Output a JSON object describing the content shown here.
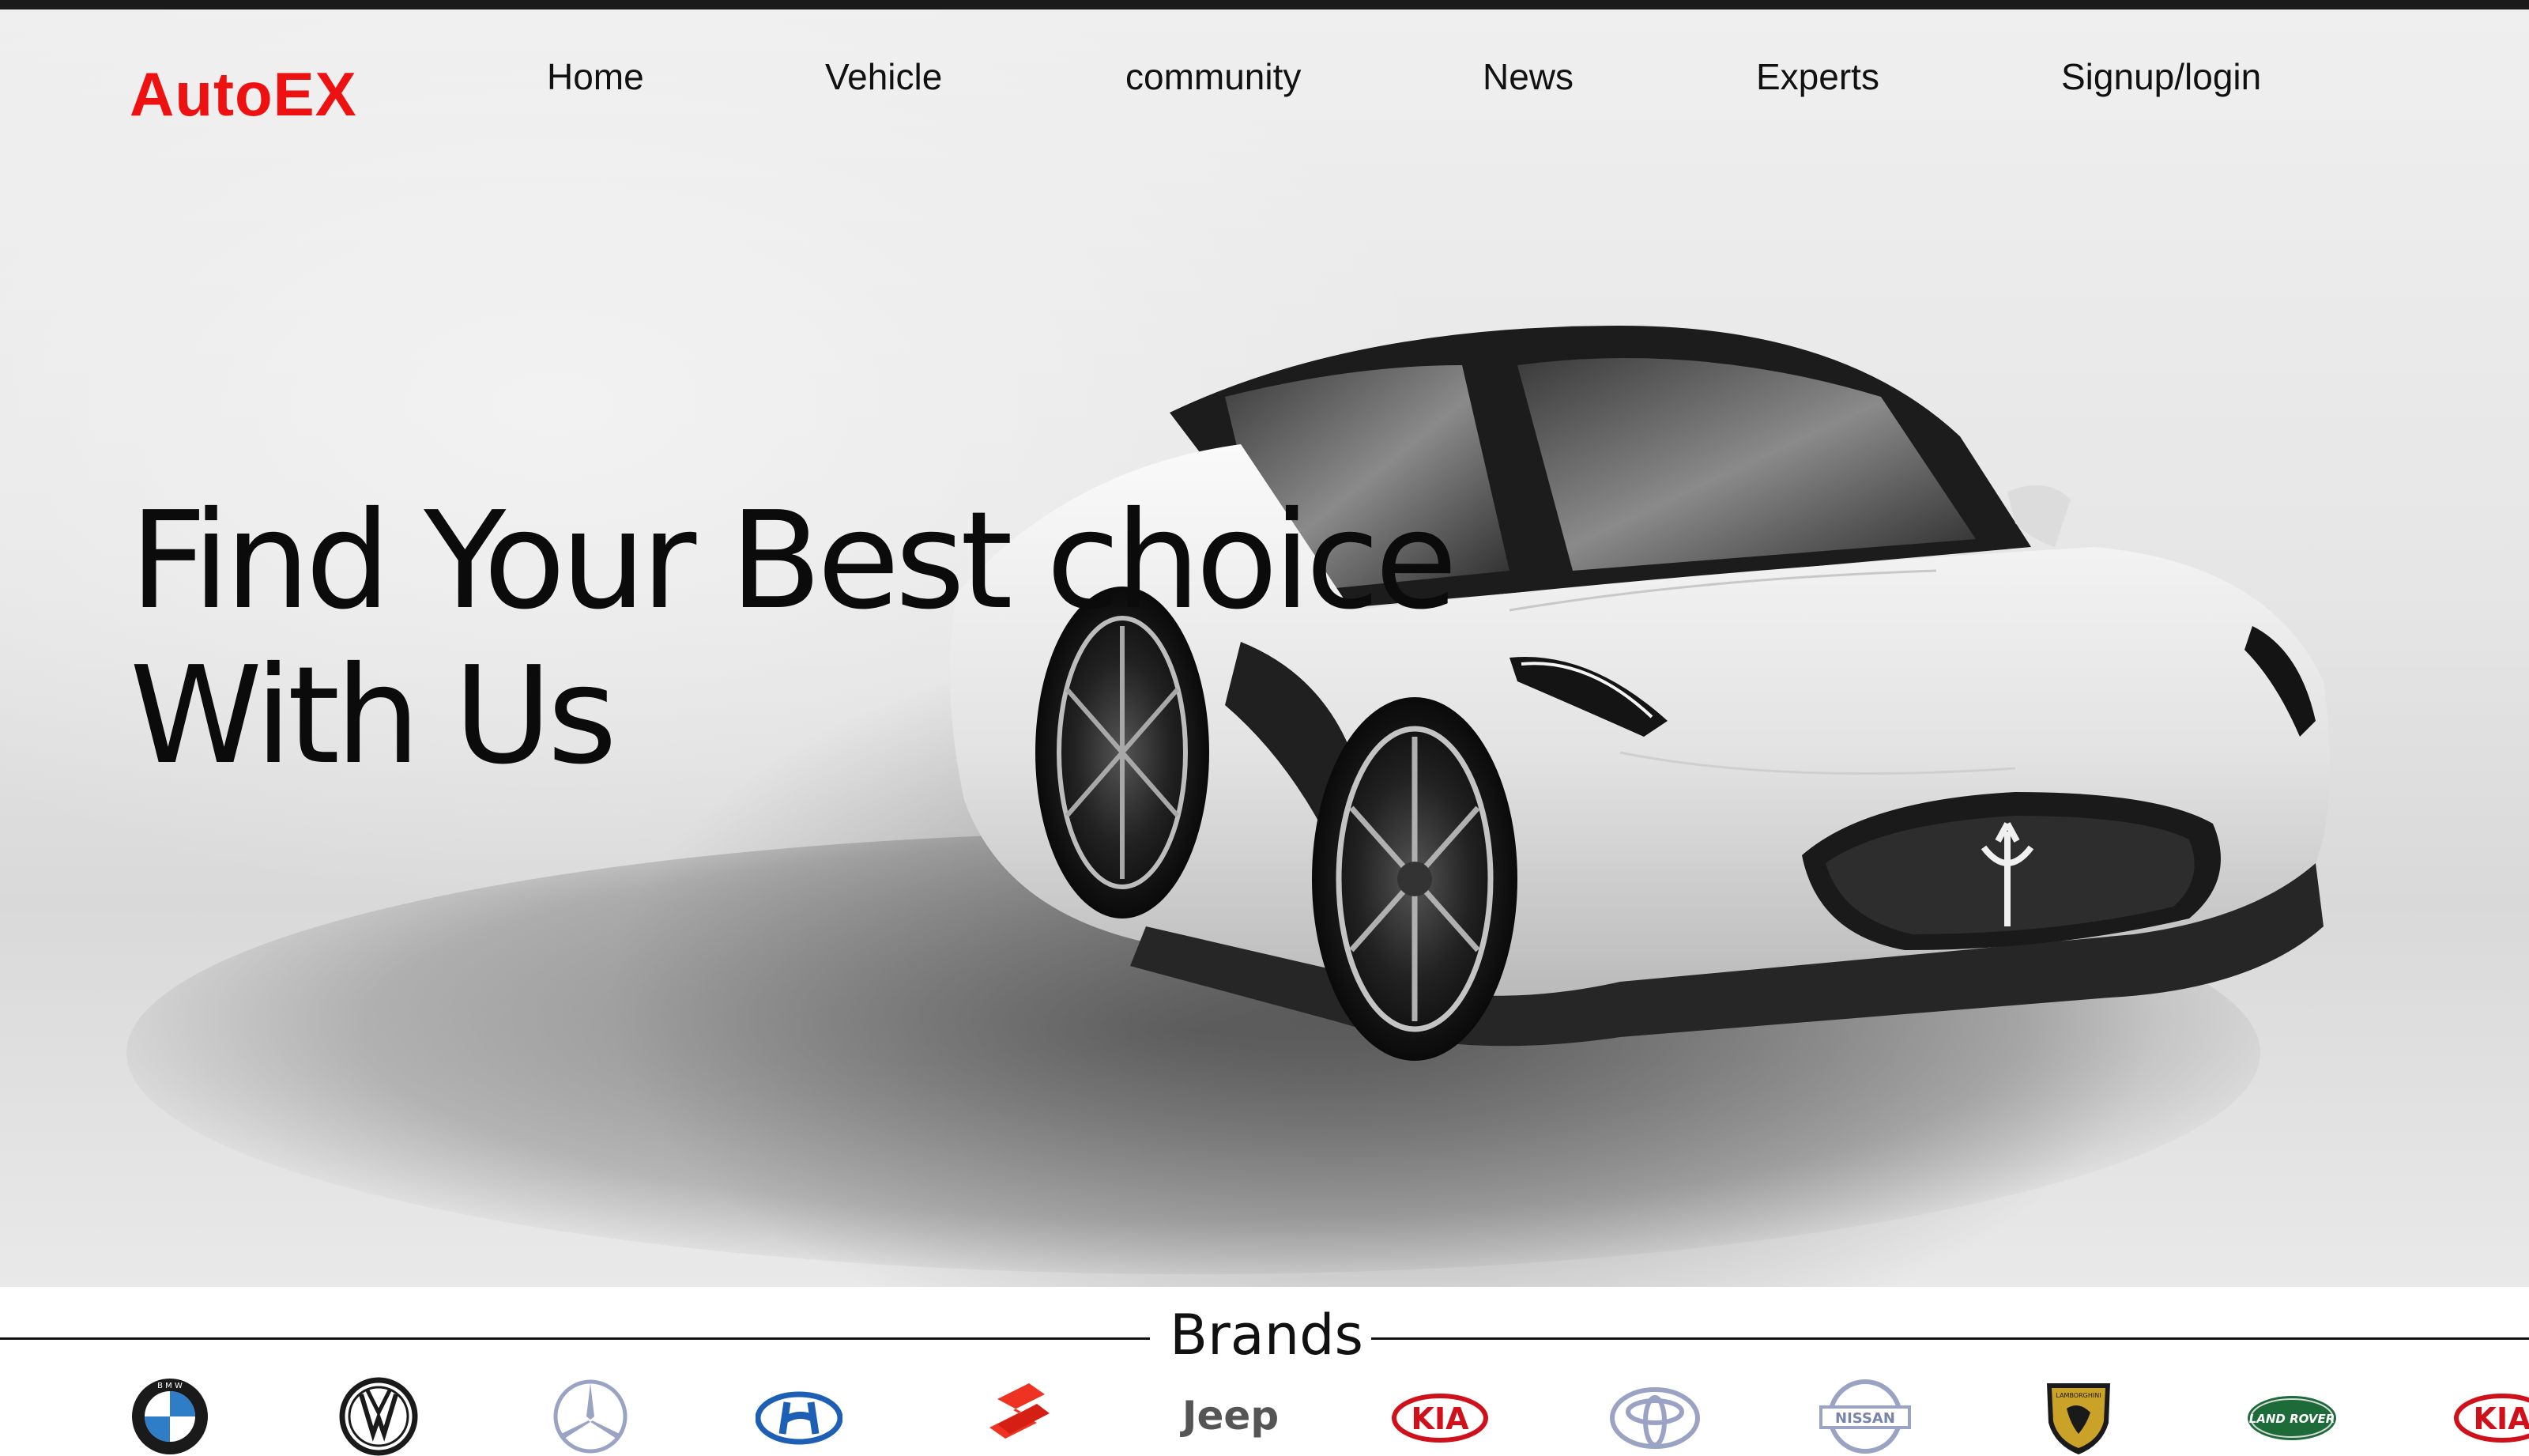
{
  "brand": {
    "name": "AutoEX",
    "color": "#ee1111"
  },
  "nav": {
    "items": [
      {
        "label": "Home"
      },
      {
        "label": "Vehicle"
      },
      {
        "label": "community"
      },
      {
        "label": "News"
      },
      {
        "label": "Experts"
      },
      {
        "label": "Signup/login"
      }
    ]
  },
  "hero": {
    "headline_line1": "Find Your Best choice",
    "headline_line2": "With Us",
    "image": "white-sports-car-photo"
  },
  "brands": {
    "title": "Brands",
    "logos": [
      {
        "icon": "bmw-logo",
        "text": "B M W"
      },
      {
        "icon": "volkswagen-logo"
      },
      {
        "icon": "mercedes-benz-logo"
      },
      {
        "icon": "hyundai-logo"
      },
      {
        "icon": "suzuki-logo"
      },
      {
        "icon": "jeep-logo",
        "text": "Jeep"
      },
      {
        "icon": "kia-logo",
        "text": "KIA"
      },
      {
        "icon": "toyota-logo"
      },
      {
        "icon": "nissan-logo",
        "text": "NISSAN"
      },
      {
        "icon": "lamborghini-logo",
        "text": "LAMBORGHINI"
      },
      {
        "icon": "land-rover-logo",
        "text": "LAND ROVER"
      },
      {
        "icon": "kia-logo",
        "text": "KIA"
      }
    ]
  }
}
